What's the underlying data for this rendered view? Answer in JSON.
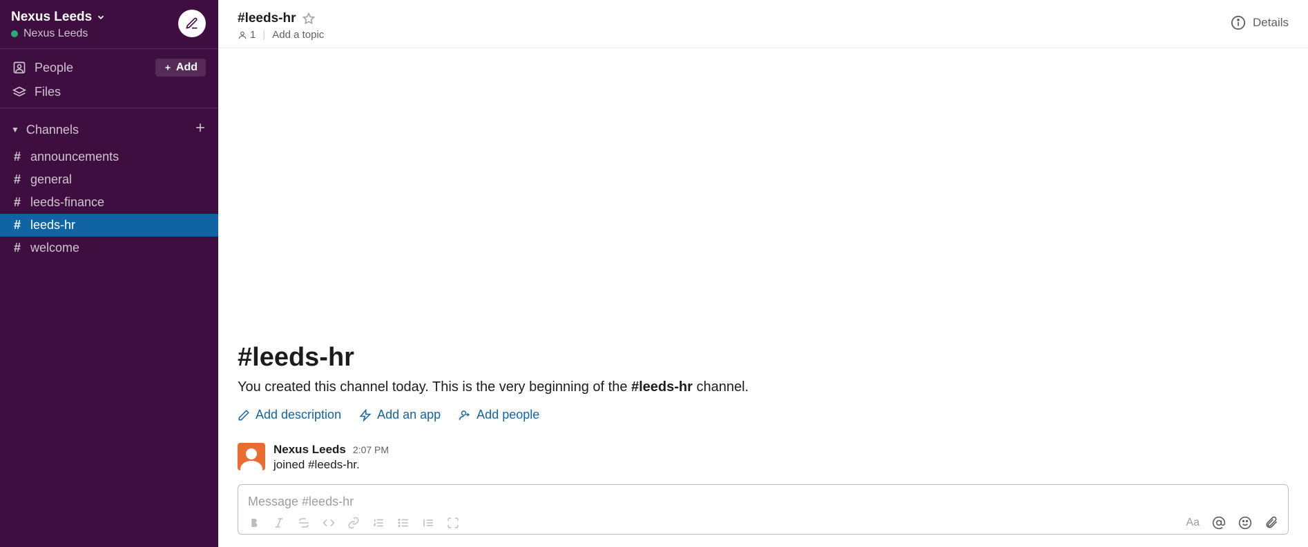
{
  "workspace": {
    "name": "Nexus Leeds",
    "user": "Nexus Leeds"
  },
  "sidebar": {
    "people_label": "People",
    "files_label": "Files",
    "add_label": "Add",
    "channels_header": "Channels",
    "channels": [
      {
        "name": "announcements",
        "active": false
      },
      {
        "name": "general",
        "active": false
      },
      {
        "name": "leeds-finance",
        "active": false
      },
      {
        "name": "leeds-hr",
        "active": true
      },
      {
        "name": "welcome",
        "active": false
      }
    ]
  },
  "header": {
    "channel_title": "#leeds-hr",
    "member_count": "1",
    "add_topic": "Add a topic",
    "details_label": "Details"
  },
  "intro": {
    "heading": "#leeds-hr",
    "line_prefix": "You created this channel today. This is the very beginning of the ",
    "line_bold": "#leeds-hr",
    "line_suffix": " channel.",
    "add_description": "Add description",
    "add_app": "Add an app",
    "add_people": "Add people"
  },
  "message": {
    "author": "Nexus Leeds",
    "time": "2:07 PM",
    "text": "joined #leeds-hr."
  },
  "composer": {
    "placeholder": "Message #leeds-hr"
  }
}
